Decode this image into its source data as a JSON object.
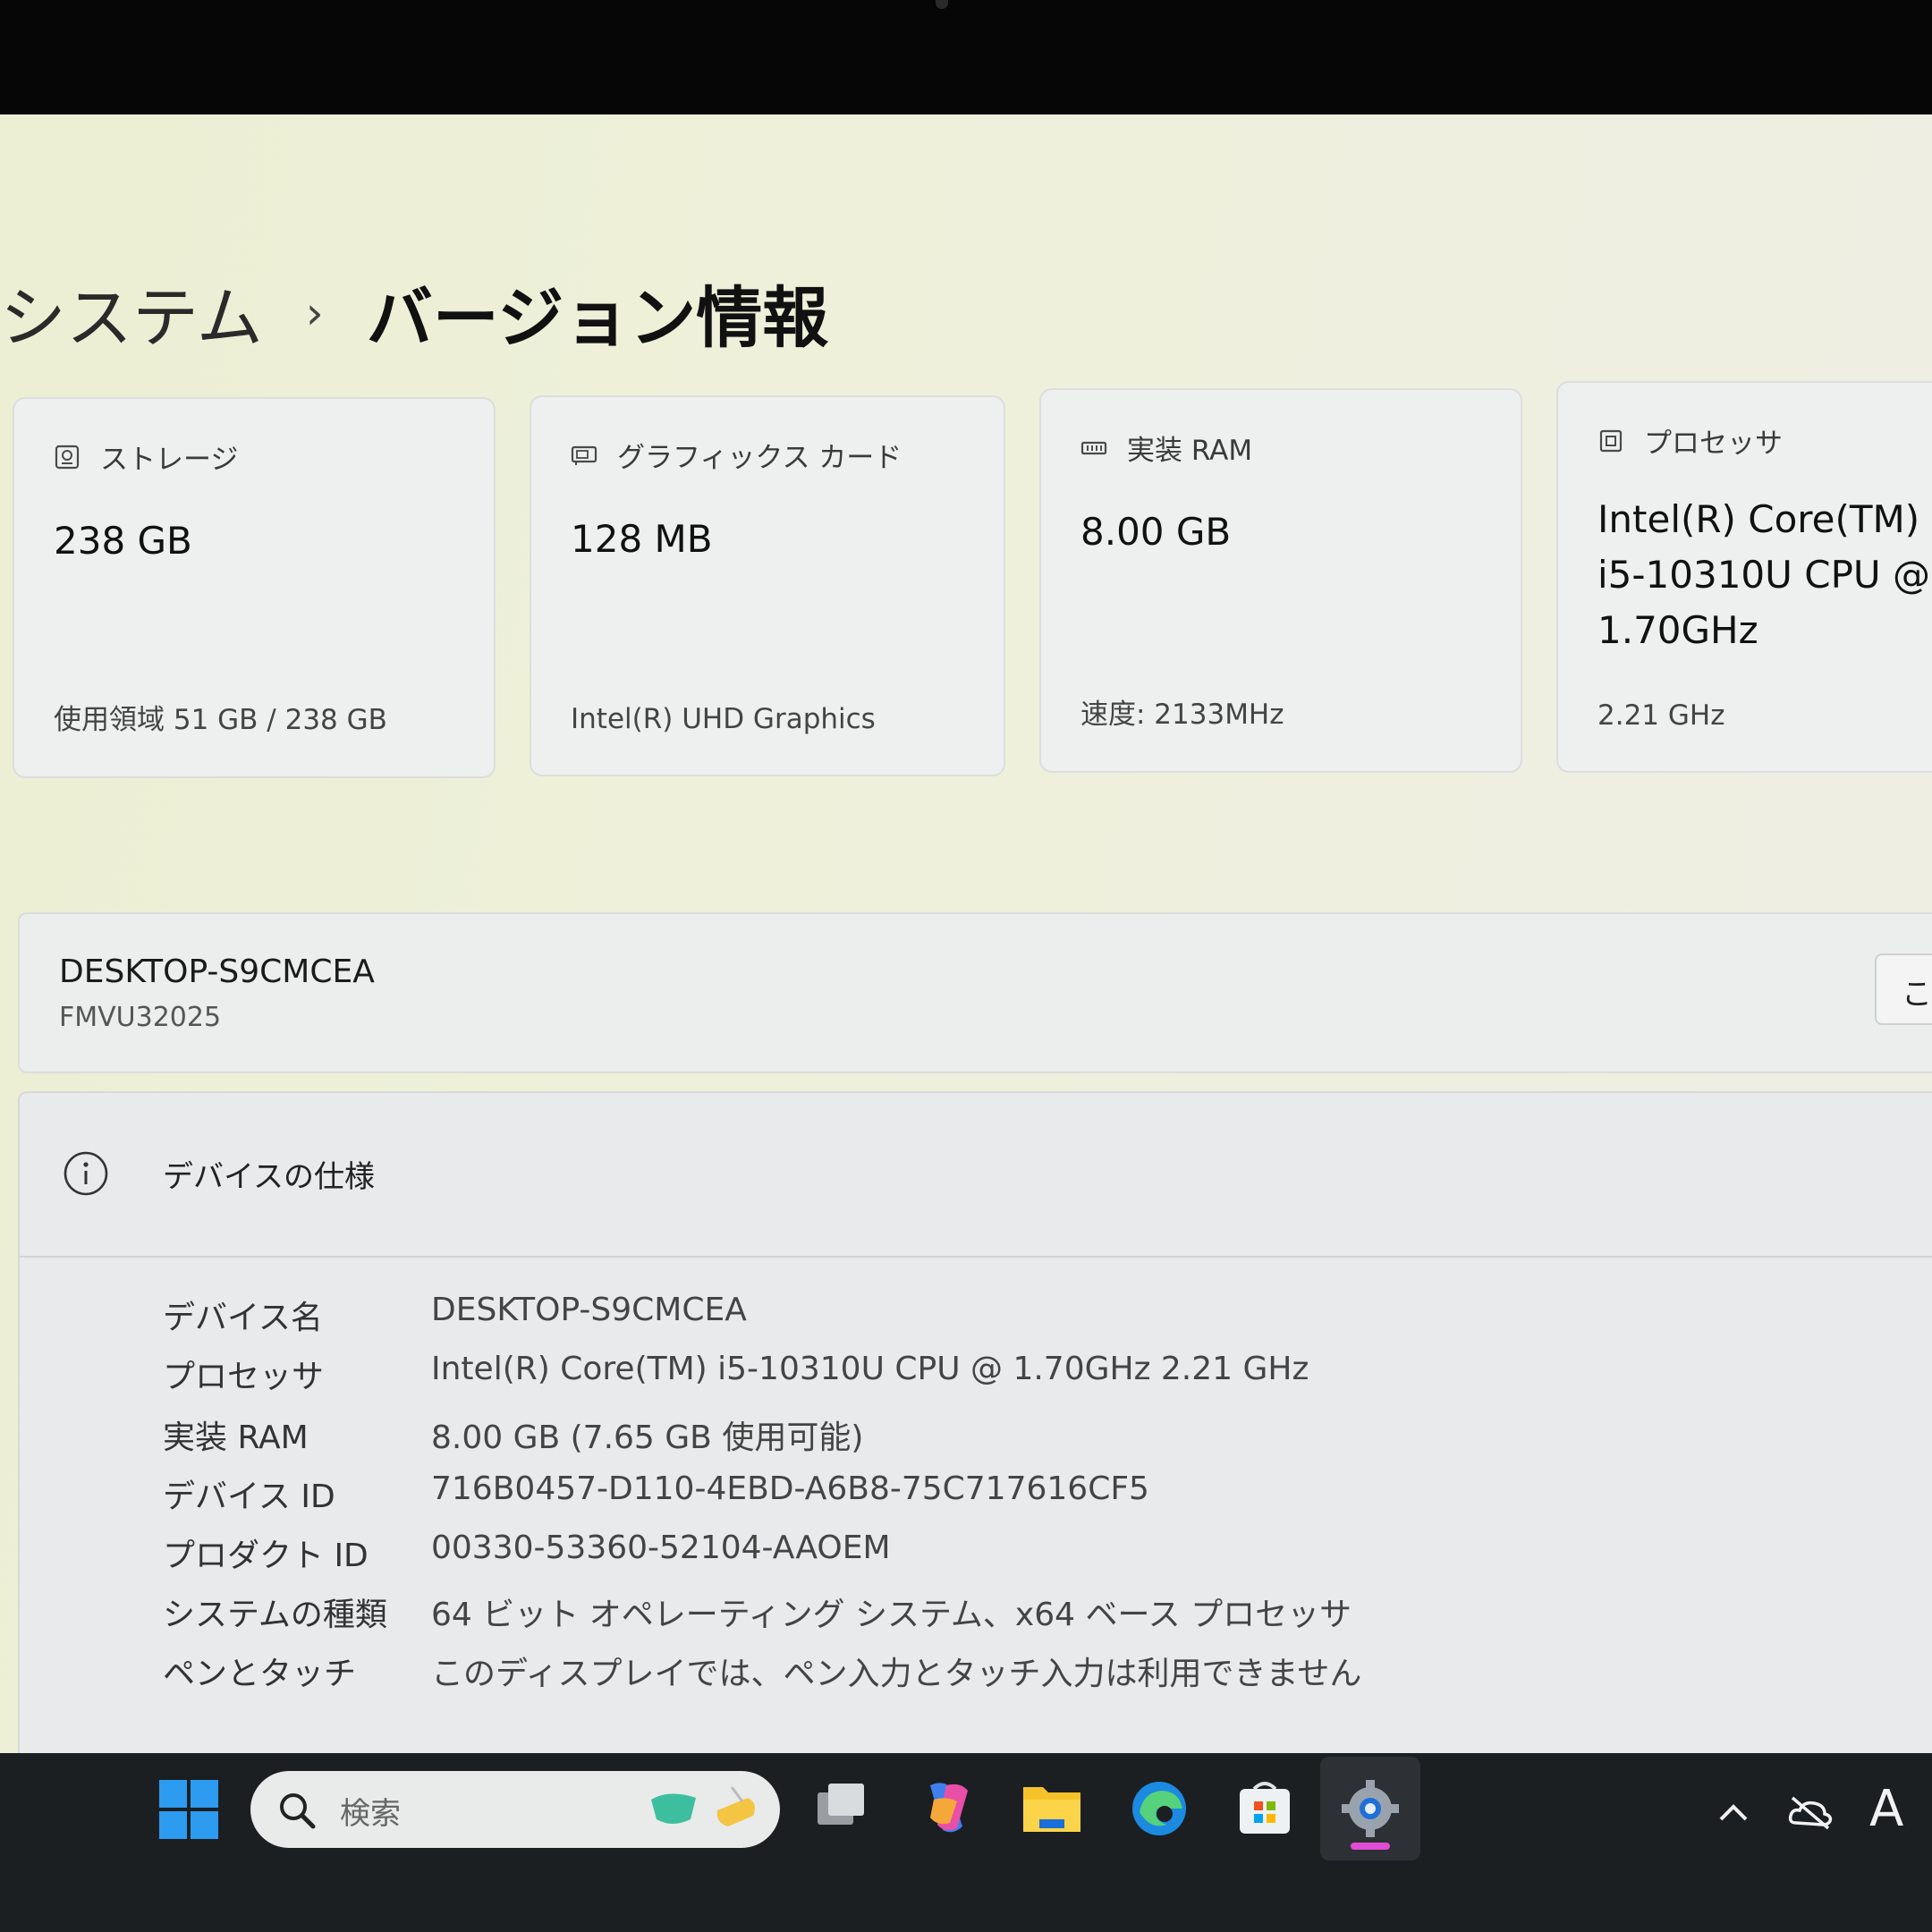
{
  "breadcrumb": {
    "parent": "システム",
    "separator": "›",
    "current": "バージョン情報"
  },
  "cards": [
    {
      "label": "ストレージ",
      "icon": "storage-icon",
      "value": "238 GB",
      "sub": "使用領域 51 GB / 238 GB"
    },
    {
      "label": "グラフィックス カード",
      "icon": "graphics-card-icon",
      "value": "128 MB",
      "sub": "Intel(R) UHD Graphics"
    },
    {
      "label": "実装 RAM",
      "icon": "ram-icon",
      "value": "8.00 GB",
      "sub": "速度: 2133MHz"
    },
    {
      "label": "プロセッサ",
      "icon": "processor-icon",
      "value_lines": [
        "Intel(R) Core(TM)",
        "i5-10310U CPU @",
        "1.70GHz"
      ],
      "sub": "2.21 GHz"
    }
  ],
  "device": {
    "name": "DESKTOP-S9CMCEA",
    "model": "FMVU32025",
    "rename_partial": "こ("
  },
  "specs": {
    "title": "デバイスの仕様",
    "rows": [
      {
        "label": "デバイス名",
        "value": "DESKTOP-S9CMCEA"
      },
      {
        "label": "プロセッサ",
        "value": "Intel(R) Core(TM) i5-10310U CPU @ 1.70GHz   2.21 GHz"
      },
      {
        "label": "実装 RAM",
        "value": "8.00 GB (7.65 GB 使用可能)"
      },
      {
        "label": "デバイス ID",
        "value": "716B0457-D110-4EBD-A6B8-75C717616CF5"
      },
      {
        "label": "プロダクト ID",
        "value": "00330-53360-52104-AAOEM"
      },
      {
        "label": "システムの種類",
        "value": "64 ビット オペレーティング システム、x64 ベース プロセッサ"
      },
      {
        "label": "ペンとタッチ",
        "value": "このディスプレイでは、ペン入力とタッチ入力は利用できません"
      }
    ]
  },
  "taskbar": {
    "search_placeholder": "検索",
    "icons": [
      "start-icon",
      "task-view-icon",
      "copilot-icon",
      "file-explorer-icon",
      "edge-icon",
      "store-icon",
      "settings-icon"
    ],
    "tray": {
      "ime": "A"
    }
  },
  "colors": {
    "accent_pink": "#e14cd6",
    "edge_blue": "#1b8ae0",
    "folder_yellow": "#f6c22a"
  }
}
